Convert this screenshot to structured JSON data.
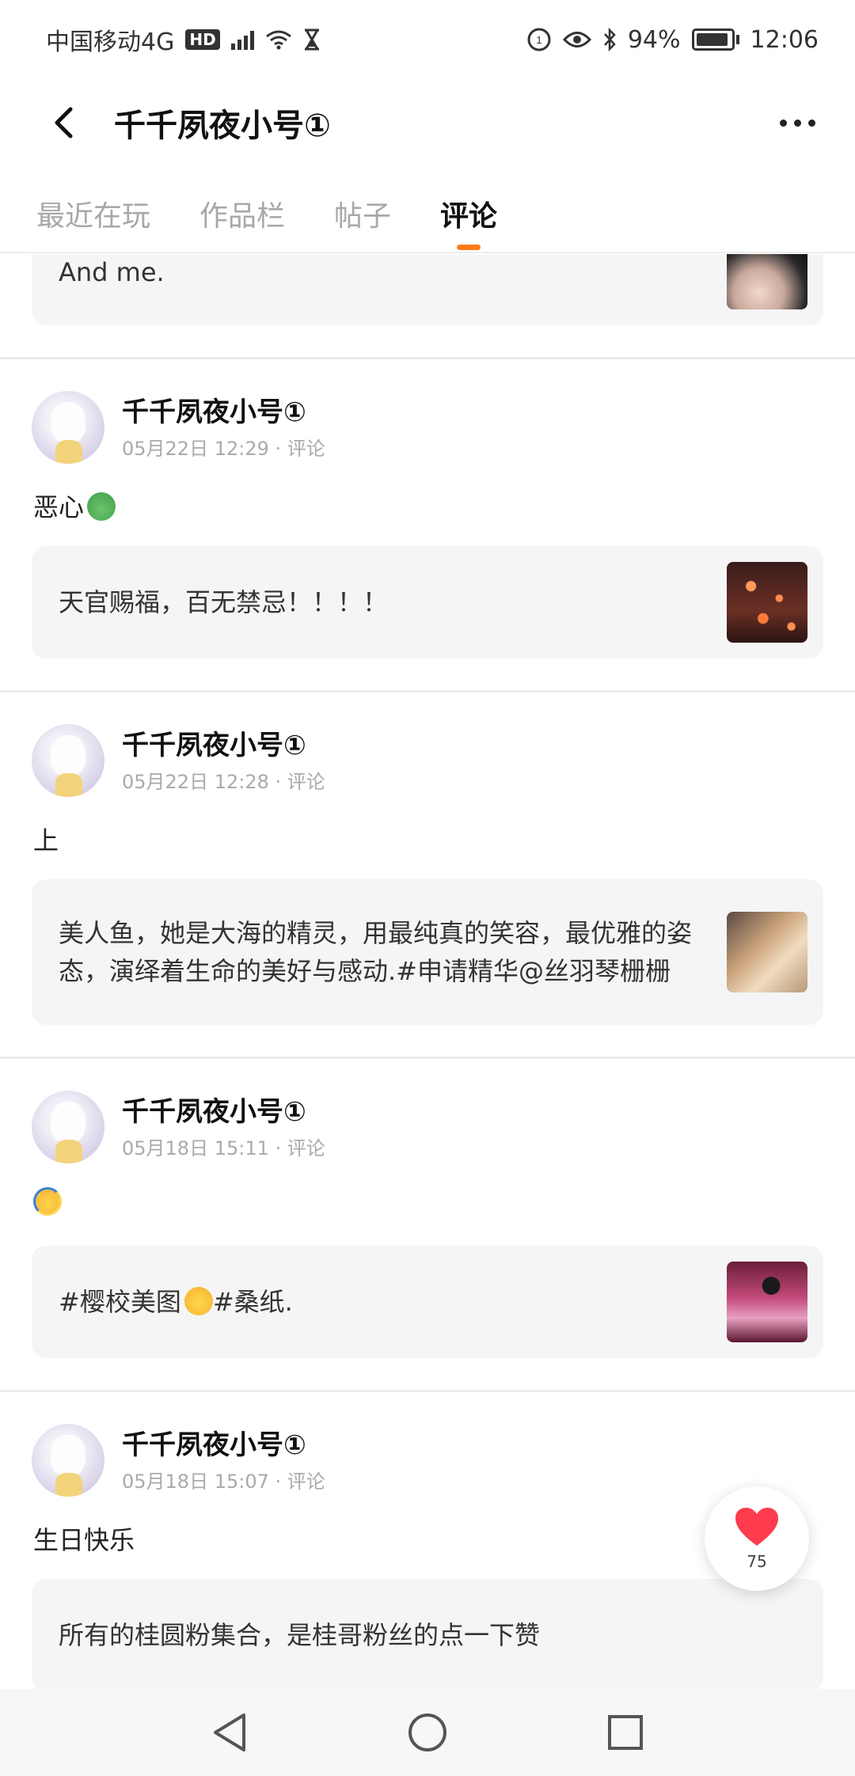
{
  "status_bar": {
    "carrier": "中国移动4G",
    "hd": "HD",
    "network": "4G",
    "battery_text": "94",
    "battery_percent": 94,
    "time": "12:06"
  },
  "nav": {
    "title": "千千夙夜小号①"
  },
  "tabs": [
    {
      "label": "最近在玩",
      "active": false
    },
    {
      "label": "作品栏",
      "active": false
    },
    {
      "label": "帖子",
      "active": false
    },
    {
      "label": "评论",
      "active": true
    }
  ],
  "partial_card": {
    "text": "And me."
  },
  "posts": [
    {
      "author": "千千夙夜小号①",
      "meta": "05月22日 12:29 · 评论",
      "comment": "恶心",
      "emoji": "nauseated-face-icon",
      "quoted": "天官赐福，百无禁忌！！！！"
    },
    {
      "author": "千千夙夜小号①",
      "meta": "05月22日 12:28 · 评论",
      "comment": "上",
      "quoted": "美人鱼，她是大海的精灵，用最纯真的笑容，最优雅的姿态，演绎着生命的美好与感动.#申请精华@丝羽琴栅栅"
    },
    {
      "author": "千千夙夜小号①",
      "meta": "05月18日 15:11 · 评论",
      "comment": "",
      "emoji": "sweat-face-icon",
      "quoted_a": "#樱校美图",
      "quoted_b": "#桑纸."
    },
    {
      "author": "千千夙夜小号①",
      "meta": "05月18日 15:07 · 评论",
      "comment": "生日快乐",
      "quoted": "所有的桂圆粉集合，是桂哥粉丝的点一下赞"
    }
  ],
  "like": {
    "count": "75"
  },
  "colors": {
    "accent": "#ff7a1a",
    "like": "#ff3b4e",
    "card_bg": "#f5f5f5"
  }
}
